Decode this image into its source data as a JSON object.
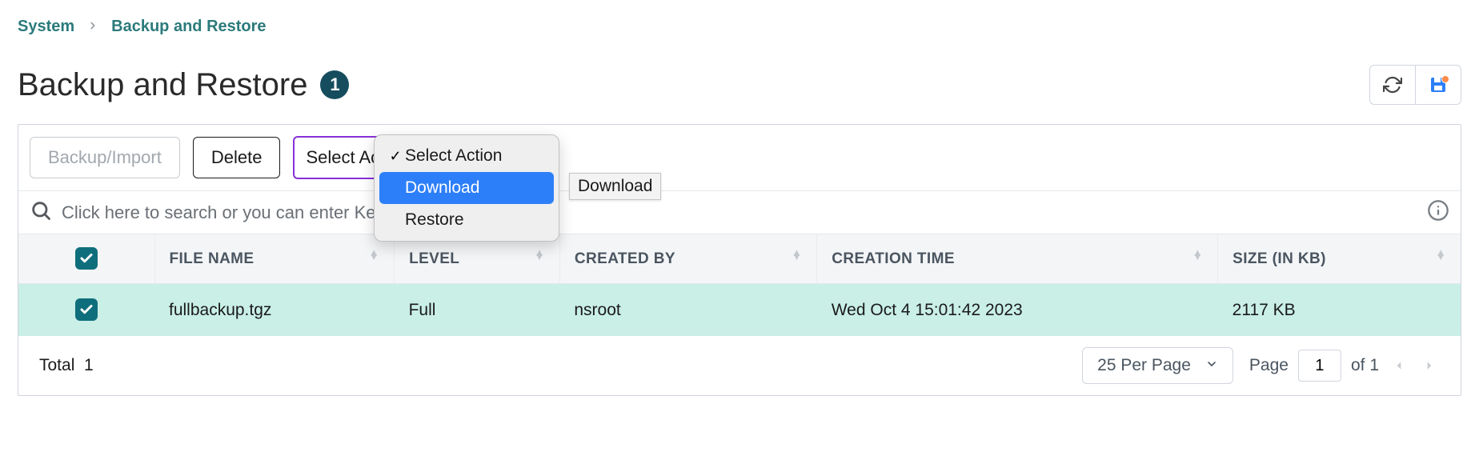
{
  "breadcrumb": {
    "system": "System",
    "backup_restore": "Backup and Restore"
  },
  "header": {
    "title": "Backup and Restore",
    "count": "1"
  },
  "toolbar": {
    "backup_import": "Backup/Import",
    "delete": "Delete",
    "select_action": "Select Action"
  },
  "menu": {
    "items": [
      "Select Action",
      "Download",
      "Restore"
    ]
  },
  "tooltip": "Download",
  "search": {
    "placeholder": "Click here to search or you can enter Key : Value format"
  },
  "table": {
    "headers": [
      "FILE NAME",
      "LEVEL",
      "CREATED BY",
      "CREATION TIME",
      "SIZE (IN KB)"
    ],
    "rows": [
      {
        "file_name": "fullbackup.tgz",
        "level": "Full",
        "created_by": "nsroot",
        "creation_time": "Wed Oct  4 15:01:42 2023",
        "size": "2117 KB"
      }
    ]
  },
  "footer": {
    "total_label": "Total",
    "total_count": "1",
    "page_size": "25 Per Page",
    "page_label": "Page",
    "current_page": "1",
    "of_label": "of",
    "total_pages": "1"
  }
}
